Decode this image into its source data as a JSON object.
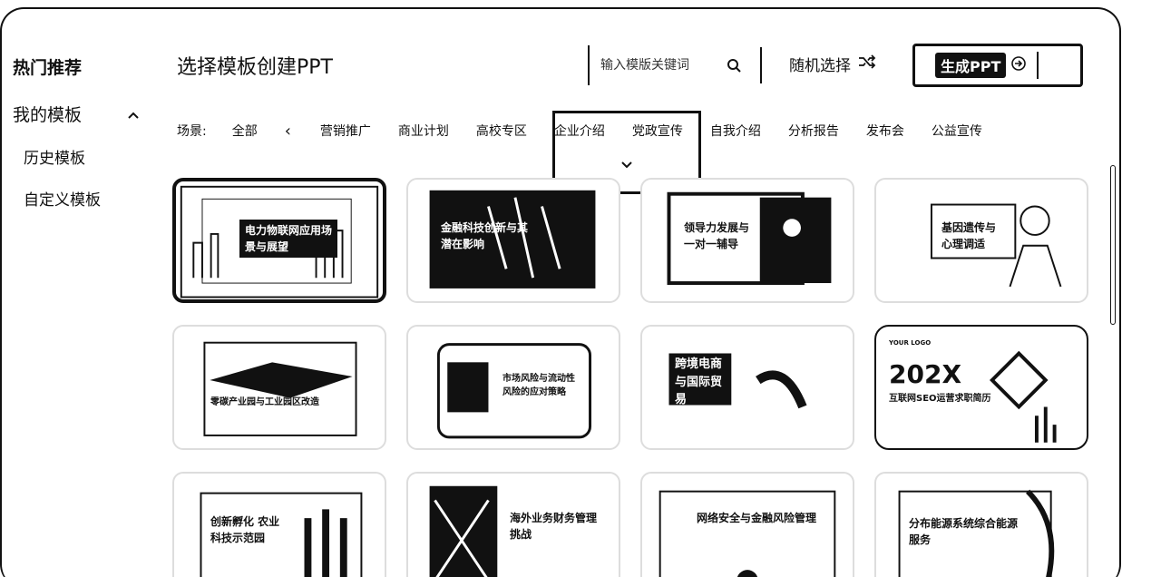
{
  "sidebar": {
    "hot": "热门推荐",
    "mine": "我的模板",
    "history": "历史模板",
    "custom": "自定义模板"
  },
  "header": {
    "title": "选择模板创建PPT",
    "search_placeholder": "输入模版关键词",
    "random_label": "随机选择",
    "generate_label": "生成PPT"
  },
  "filters": {
    "scene_label": "场景:",
    "tabs": [
      "全部",
      "营销推广",
      "商业计划",
      "高校专区",
      "企业介绍",
      "党政宣传",
      "自我介绍",
      "分析报告",
      "发布会",
      "公益宣传"
    ]
  },
  "templates": [
    {
      "title": "电力物联网应用场景与展望"
    },
    {
      "title": "金融科技创新与其潜在影响"
    },
    {
      "title": "领导力发展与一对一辅导"
    },
    {
      "title": "基因遗传与心理调适"
    },
    {
      "title": "零碳产业园与工业园区改造"
    },
    {
      "title": "市场风险与流动性风险的应对策略"
    },
    {
      "title": "跨境电商与国际贸易"
    },
    {
      "logo": "YOUR LOGO",
      "big": "202X",
      "title": "互联网SEO运营求职简历"
    },
    {
      "title": "创新孵化 农业科技示范园"
    },
    {
      "title": "海外业务财务管理挑战"
    },
    {
      "title": "网络安全与金融风险管理"
    },
    {
      "title": "分布能源系统综合能源服务"
    }
  ]
}
